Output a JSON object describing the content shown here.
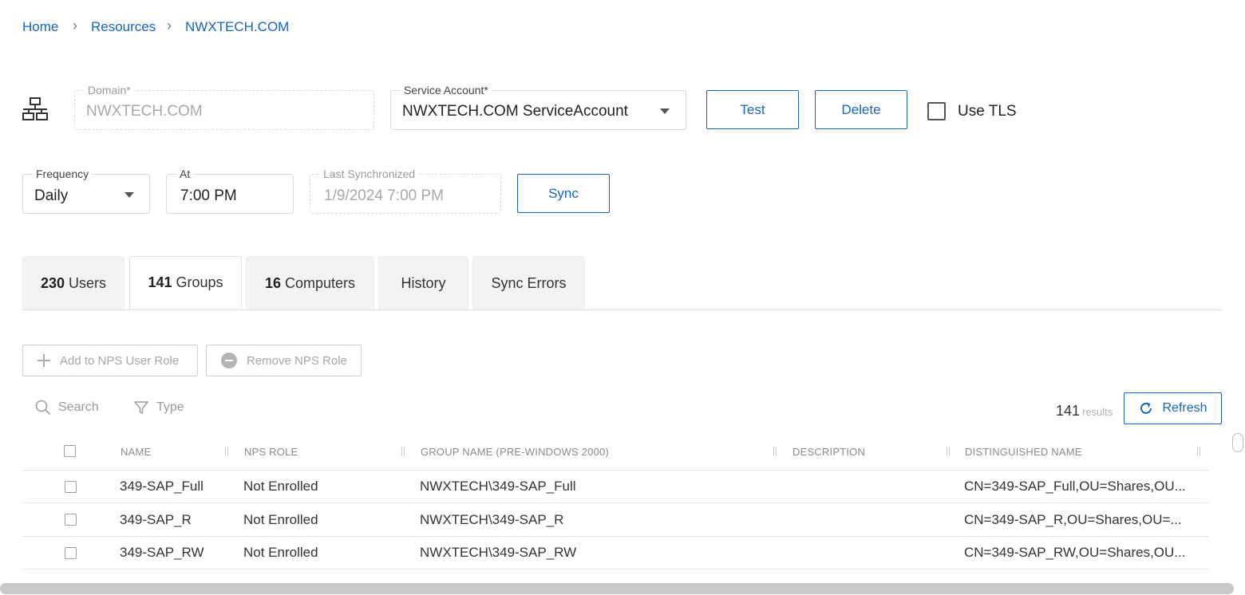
{
  "breadcrumb": {
    "items": [
      "Home",
      "Resources",
      "NWXTECH.COM"
    ],
    "separator": "›"
  },
  "domain_form": {
    "icon": "network-icon",
    "domain": {
      "label": "Domain*",
      "value": "NWXTECH.COM"
    },
    "service_account": {
      "label": "Service Account*",
      "value": "NWXTECH.COM ServiceAccount"
    },
    "test_label": "Test",
    "delete_label": "Delete",
    "use_tls_label": "Use TLS"
  },
  "sync_form": {
    "frequency": {
      "label": "Frequency",
      "value": "Daily"
    },
    "at": {
      "label": "At",
      "value": "7:00 PM"
    },
    "last_synchronized": {
      "label": "Last Synchronized",
      "value": "1/9/2024 7:00 PM"
    },
    "sync_label": "Sync"
  },
  "tabs": [
    {
      "count": "230",
      "label": "Users"
    },
    {
      "count": "141",
      "label": "Groups",
      "active": true
    },
    {
      "count": "16",
      "label": "Computers"
    },
    {
      "count": "",
      "label": "History"
    },
    {
      "count": "",
      "label": "Sync Errors"
    }
  ],
  "actions": {
    "add_label": "Add to NPS User Role",
    "remove_label": "Remove NPS Role"
  },
  "toolbar": {
    "search_label": "Search",
    "type_label": "Type",
    "results_count": "141",
    "results_label": "results",
    "refresh_label": "Refresh"
  },
  "table": {
    "columns": [
      "NAME",
      "NPS ROLE",
      "GROUP NAME (PRE-WINDOWS 2000)",
      "DESCRIPTION",
      "DISTINGUISHED NAME"
    ],
    "rows": [
      {
        "name": "349-SAP_Full",
        "nps_role": "Not Enrolled",
        "group_name": "NWXTECH\\349-SAP_Full",
        "description": "",
        "dn": "CN=349-SAP_Full,OU=Shares,OU..."
      },
      {
        "name": "349-SAP_R",
        "nps_role": "Not Enrolled",
        "group_name": "NWXTECH\\349-SAP_R",
        "description": "",
        "dn": "CN=349-SAP_R,OU=Shares,OU=..."
      },
      {
        "name": "349-SAP_RW",
        "nps_role": "Not Enrolled",
        "group_name": "NWXTECH\\349-SAP_RW",
        "description": "",
        "dn": "CN=349-SAP_RW,OU=Shares,OU..."
      }
    ]
  },
  "colors": {
    "accent": "#1565c0",
    "tab_bg": "#f2f3f5",
    "border": "#d9d9d9"
  }
}
